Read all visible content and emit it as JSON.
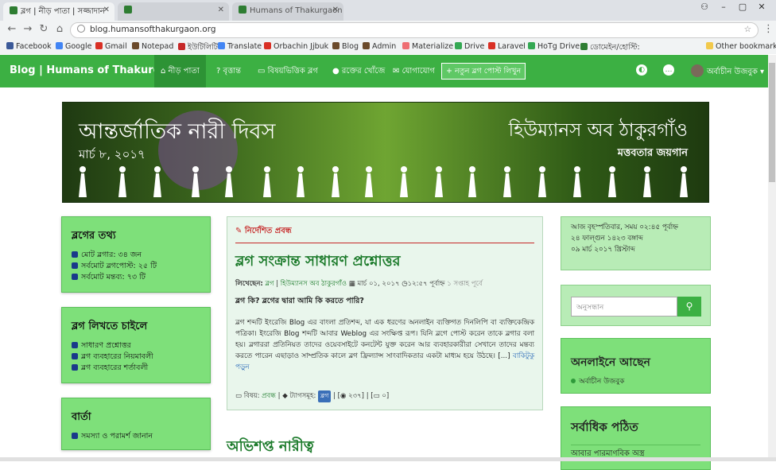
{
  "browser": {
    "tabs": [
      {
        "label": "ব্লগ | নীড় পাতা | সজ্জাদান",
        "active": true
      },
      {
        "label": "",
        "active": false
      },
      {
        "label": "Humans of Thakurgaon",
        "active": false
      }
    ],
    "url": "blog.humansofthakurgaon.org",
    "bookmarks": [
      {
        "label": "Facebook",
        "color": "#3b5998"
      },
      {
        "label": "Google",
        "color": "#4285f4"
      },
      {
        "label": "Gmail",
        "color": "#d93025"
      },
      {
        "label": "Notepad",
        "color": "#6b4a2b"
      },
      {
        "label": "ইউটিলিটি",
        "color": "#c62828"
      },
      {
        "label": "Translate",
        "color": "#4285f4"
      },
      {
        "label": "Orbachin Jjbuk",
        "color": "#d93025"
      },
      {
        "label": "Blog",
        "color": "#6b4a2b"
      },
      {
        "label": "Admin",
        "color": "#6b4a2b"
      },
      {
        "label": "Materialize",
        "color": "#ee6e73"
      },
      {
        "label": "Drive",
        "color": "#34a853"
      },
      {
        "label": "Laravel",
        "color": "#d93025"
      },
      {
        "label": "HoTg Drive",
        "color": "#34a853"
      },
      {
        "label": "ডোমেইন/হোস্টি:",
        "color": "#2e7d32"
      },
      {
        "label": "Other bookmarks",
        "color": "#f2c94c"
      }
    ]
  },
  "nav": {
    "brand": "Blog | Humans of Thakurgaon",
    "links": [
      {
        "label": "নীড় পাতা",
        "icon": "home-icon",
        "active": true
      },
      {
        "label": "বৃত্তান্ত",
        "icon": "question-icon",
        "active": false
      },
      {
        "label": "বিষয়ভিত্তিক ব্লগ",
        "icon": "folder-icon",
        "active": false
      },
      {
        "label": "রক্তের খোঁজে",
        "icon": "drop-icon",
        "active": false
      },
      {
        "label": "যোগাযোগ",
        "icon": "mail-icon",
        "active": false
      }
    ],
    "new_post": "নতুন ব্লগ পোস্ট লিখুন",
    "user_name": "অর্বাচীন উজবুক"
  },
  "banner": {
    "title_left": "আন্তর্জাতিক নারী দিবস",
    "date_left": "মার্চ ৮, ২০১৭",
    "title_right": "হিউম্যানস অব ঠাকুরগাঁও",
    "tagline_right": "মত্তবতার জয়গান"
  },
  "left": {
    "info_title": "ব্লগের তথ্য",
    "info_items": [
      "মোট ব্লগার: ৩৪ জন",
      "সর্বমোট ব্লগপোস্ট: ২৫ টি",
      "সর্বমোট মন্তব্য: ৭৩ টি"
    ],
    "write_title": "ব্লগ লিখতে চাইলে",
    "write_items": [
      "সাধারণ প্রশ্নোত্তর",
      "ব্লগ ব্যবহারের নিয়মাবলী",
      "ব্লগ ব্যবহারের শর্তাবলী"
    ],
    "msg_title": "বার্তা",
    "msg_items": [
      "সমস্যা ও পরামর্শ জানান"
    ]
  },
  "article": {
    "featured": "নির্দেশিত প্রবন্ধ",
    "title": "ব্লগ সংক্রান্ত সাধারণ প্রশ্নোত্তর",
    "meta_by": "লিখেছেন:",
    "meta_cat": "ব্লগ",
    "meta_author": "হিউম্যানস অব ঠাকুরগাঁও",
    "meta_date": "মার্চ ০১, ২০১৭",
    "meta_time": "১২:৫৭ পূর্বাহ্ন",
    "meta_ago": "১ সপ্তাহ পূর্বে",
    "question": "ব্লগ কি? ব্লগের দ্বারা আমি কি করতে পারি?",
    "body": "ব্লগ শব্দটি ইংরেজি Blog এর বাংলা প্রতিশব্দ, যা এক ধরণের অনলাইন ব্যক্তিগত দিনলিপি বা ব্যক্তিকেন্দ্রিক পত্রিকা। ইংরেজি Blog শব্দটি আবার Weblog এর সংক্ষিপ্ত রূপ। যিনি ব্লগে পোস্ট করেন তাকে ব্লগার বলা হয়। ব্লগাররা প্রতিনিয়ত তাদের ওয়েবসাইটে কনটেন্ট যুক্ত করেন আর ব্যবহারকারীরা সেখানে তাদের মন্তব্য করতে পারেন  এছাড়াও সাম্প্রতিক কালে ব্লগ ফ্রিল্যান্স সাংবাদিকতার একটা মাধ্যম হয়ে উঠছে। [...]",
    "more": "বাকিটুকু পড়ুন",
    "footer_subject": "বিষয়:",
    "footer_subject_link": "প্রবন্ধ",
    "footer_tags": "ট্যাগসমূহ:",
    "footer_tag": "ব্লগ",
    "footer_views": "২৩৭",
    "footer_comments": "০",
    "next_title": "অভিশপ্ত নারীত্ব"
  },
  "right": {
    "date_lines": [
      "আজ বৃহস্পতিবার, সময় ০২:৪৫ পূর্বাহ্ন",
      "২৪ ফাল্গুন ১৪২৩ বঙ্গাব্দ",
      "০৯ মার্চ ২০১৭ খ্রিস্টাব্দ"
    ],
    "search_placeholder": "অনুসন্ধান",
    "online_title": "অনলাইনে আছেন",
    "online_user": "অর্বাচীন উজবুক",
    "popular_title": "সর্বাধিক পঠিত",
    "popular_first": "আবার পারমাণবিক অস্ত্র"
  },
  "colors": {
    "nav_green": "#3cb043",
    "sidebar_green": "#7ee07a",
    "title_green": "#1b7a2a",
    "featured_red": "#c62828"
  }
}
